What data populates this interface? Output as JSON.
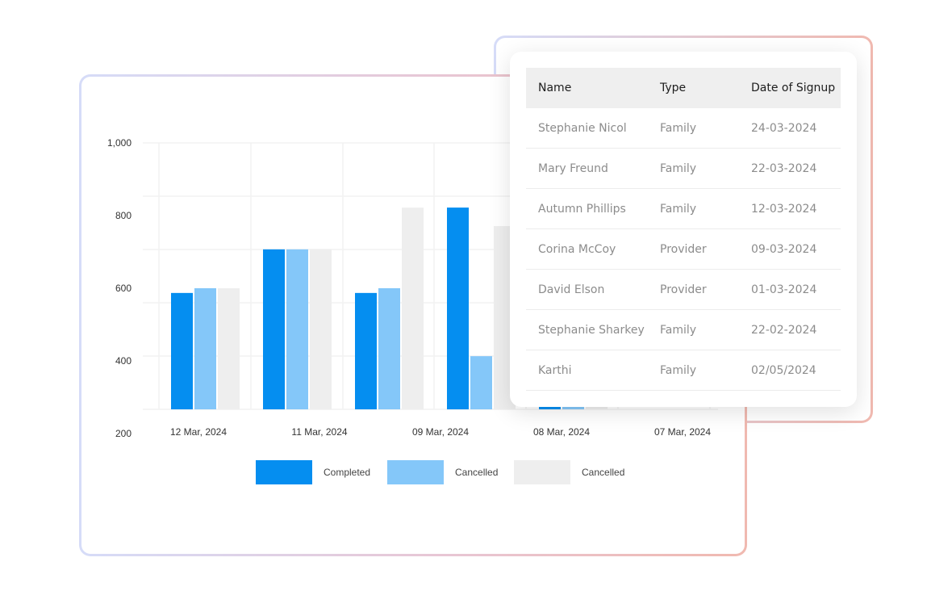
{
  "colors": {
    "completed": "#058ef0",
    "cancelled_light": "#84c7f9",
    "cancelled_grey": "#eeeeee",
    "grid": "#f2f2f2"
  },
  "chart_data": {
    "type": "bar",
    "title": "",
    "xlabel": "",
    "ylabel": "",
    "y_ticks": [
      "1,000",
      "800",
      "600",
      "400",
      "200"
    ],
    "ylim": [
      200,
      1000
    ],
    "grid": true,
    "legend_position": "bottom",
    "categories": [
      "12 Mar, 2024",
      "11 Mar, 2024",
      "09 Mar, 2024",
      "08 Mar, 2024",
      "07 Mar, 2024"
    ],
    "series": [
      {
        "name": "Completed",
        "values": [
          587,
          707,
          587,
          822,
          280
        ]
      },
      {
        "name": "Cancelled",
        "values": [
          600,
          707,
          600,
          413,
          280
        ]
      },
      {
        "name": "Cancelled",
        "values": [
          600,
          707,
          822,
          771,
          280
        ]
      }
    ]
  },
  "table": {
    "headers": [
      "Name",
      "Type",
      "Date of Signup"
    ],
    "rows": [
      [
        "Stephanie Nicol",
        "Family",
        "24-03-2024"
      ],
      [
        "Mary Freund",
        "Family",
        "22-03-2024"
      ],
      [
        "Autumn Phillips",
        "Family",
        "12-03-2024"
      ],
      [
        "Corina McCoy",
        "Provider",
        "09-03-2024"
      ],
      [
        "David Elson",
        "Provider",
        "01-03-2024"
      ],
      [
        "Stephanie Sharkey",
        "Family",
        "22-02-2024"
      ],
      [
        "Karthi",
        "Family",
        "02/05/2024"
      ]
    ]
  }
}
